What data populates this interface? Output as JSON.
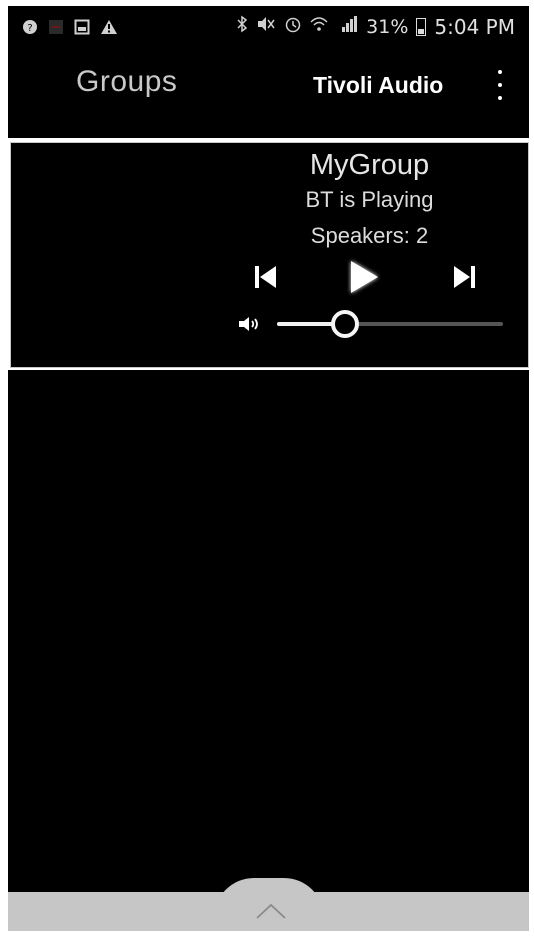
{
  "status_bar": {
    "battery_pct": "31%",
    "time": "5:04 PM",
    "icons": [
      "notification-icon",
      "app-icon",
      "image-icon",
      "warning-icon",
      "bluetooth-icon",
      "mute-icon",
      "alarm-icon",
      "wifi-icon",
      "signal-icon",
      "battery-icon"
    ]
  },
  "header": {
    "title": "Groups",
    "brand": "Tivoli Audio"
  },
  "group": {
    "name": "MyGroup",
    "status": "BT is Playing",
    "speakers_label": "Speakers:  2",
    "volume_level": 0.3
  },
  "colors": {
    "background": "#000000",
    "drawer": "#c6c6c6",
    "text": "#e6e6e6"
  }
}
